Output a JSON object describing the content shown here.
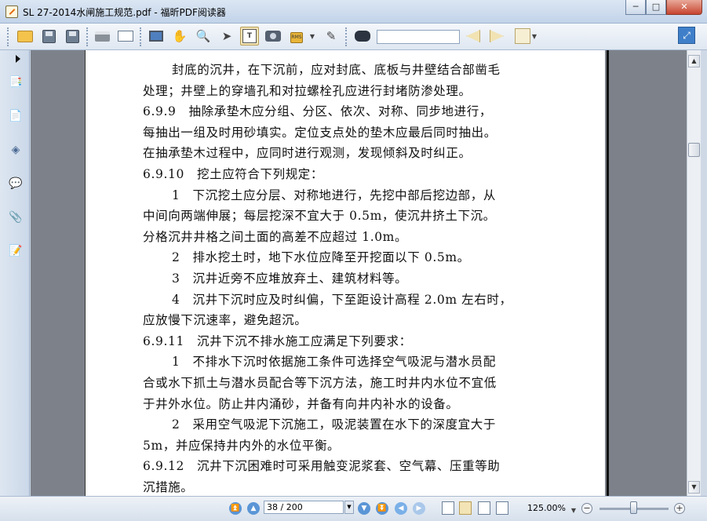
{
  "window": {
    "title": "SL 27-2014水闸施工规范.pdf - 福昕PDF阅读器",
    "minimize": "─",
    "maximize": "□",
    "close": "✕"
  },
  "toolbar": {
    "search_value": "",
    "lock_label": "RMS"
  },
  "document": {
    "lines": [
      {
        "text": "封底的沉井，在下沉前，应对封底、底板与井壁结合部凿毛",
        "indent": 1
      },
      {
        "text": "处理；井壁上的穿墙孔和对拉螺栓孔应进行封堵防渗处理。",
        "indent": 0
      },
      {
        "text": "6.9.9　抽除承垫木应分组、分区、依次、对称、同步地进行，",
        "indent": 0
      },
      {
        "text": "每抽出一组及时用砂填实。定位支点处的垫木应最后同时抽出。",
        "indent": 0
      },
      {
        "text": "在抽承垫木过程中，应同时进行观测，发现倾斜及时纠正。",
        "indent": 0
      },
      {
        "text": "6.9.10　挖土应符合下列规定：",
        "indent": 0
      },
      {
        "text": "1　下沉挖土应分层、对称地进行，先挖中部后挖边部，从",
        "indent": 1
      },
      {
        "text": "中间向两端伸展；每层挖深不宜大于 0.5m，使沉井挤土下沉。",
        "indent": 0
      },
      {
        "text": "分格沉井井格之间土面的高差不应超过 1.0m。",
        "indent": 0
      },
      {
        "text": "2　排水挖土时，地下水位应降至开挖面以下 0.5m。",
        "indent": 1
      },
      {
        "text": "3　沉井近旁不应堆放弃土、建筑材料等。",
        "indent": 1
      },
      {
        "text": "4　沉井下沉时应及时纠偏，下至距设计高程 2.0m 左右时，",
        "indent": 1
      },
      {
        "text": "应放慢下沉速率，避免超沉。",
        "indent": 0
      },
      {
        "text": "6.9.11　沉井下沉不排水施工应满足下列要求：",
        "indent": 0
      },
      {
        "text": "1　不排水下沉时依据施工条件可选择空气吸泥与潜水员配",
        "indent": 1
      },
      {
        "text": "合或水下抓土与潜水员配合等下沉方法，施工时井内水位不宜低",
        "indent": 0
      },
      {
        "text": "于井外水位。防止井内涌砂，并备有向井内补水的设备。",
        "indent": 0
      },
      {
        "text": "2　采用空气吸泥下沉施工，吸泥装置在水下的深度宜大于",
        "indent": 1
      },
      {
        "text": "5m，并应保持井内外的水位平衡。",
        "indent": 0
      },
      {
        "text": "6.9.12　沉井下沉困难时可采用触变泥浆套、空气幕、压重等助",
        "indent": 0
      },
      {
        "text": "沉措施。",
        "indent": 0
      }
    ]
  },
  "statusbar": {
    "page_indicator": "38 / 200",
    "zoom": "125.00%"
  },
  "colors": {
    "accent": "#5a95d6",
    "active_tool": "#f3e4b6",
    "page_background": "#7d828a"
  }
}
